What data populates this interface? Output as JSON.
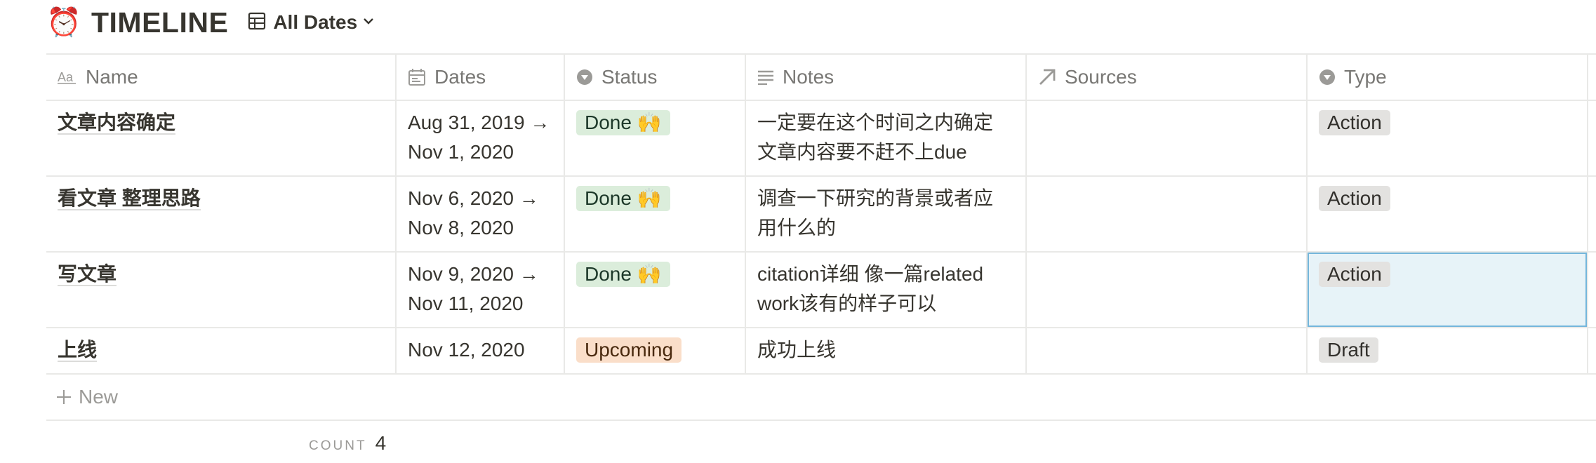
{
  "page": {
    "emoji": "⏰",
    "title": "TIMELINE",
    "view_label": "All Dates"
  },
  "table": {
    "columns": [
      {
        "label": "Name",
        "icon": "text-property-icon"
      },
      {
        "label": "Dates",
        "icon": "calendar-icon"
      },
      {
        "label": "Status",
        "icon": "select-icon"
      },
      {
        "label": "Notes",
        "icon": "text-lines-icon"
      },
      {
        "label": "Sources",
        "icon": "relation-arrow-icon"
      },
      {
        "label": "Type",
        "icon": "select-icon"
      }
    ],
    "rows": [
      {
        "name": "文章内容确定",
        "dates_line1": "Aug 31, 2019 →",
        "dates_line2": "Nov 1, 2020",
        "status": "Done 🙌",
        "notes_line1": "一定要在这个时间之内确定",
        "notes_line2": "文章内容要不赶不上due",
        "sources": "",
        "type": "Action"
      },
      {
        "name": "看文章 整理思路",
        "dates_line1": "Nov 6, 2020 →",
        "dates_line2": "Nov 8, 2020",
        "status": "Done 🙌",
        "notes_line1": "调查一下研究的背景或者应",
        "notes_line2": "用什么的",
        "sources": "",
        "type": "Action"
      },
      {
        "name": "写文章",
        "dates_line1": "Nov 9, 2020 →",
        "dates_line2": "Nov 11, 2020",
        "status": "Done 🙌",
        "notes_line1": "citation详细 像一篇related",
        "notes_line2": "work该有的样子可以",
        "sources": "",
        "type": "Action"
      },
      {
        "name": "上线",
        "dates_line1": "Nov 12, 2020",
        "dates_line2": "",
        "status": "Upcoming",
        "notes_line1": "成功上线",
        "notes_line2": "",
        "sources": "",
        "type": "Draft"
      }
    ],
    "new_label": "New"
  },
  "footer": {
    "count_label": "COUNT",
    "count_value": "4"
  },
  "colors": {
    "done_bg": "#dbeddb",
    "upcoming_bg": "#fadec9",
    "type_bg": "#e3e2e0",
    "selection": "#74b6db"
  }
}
